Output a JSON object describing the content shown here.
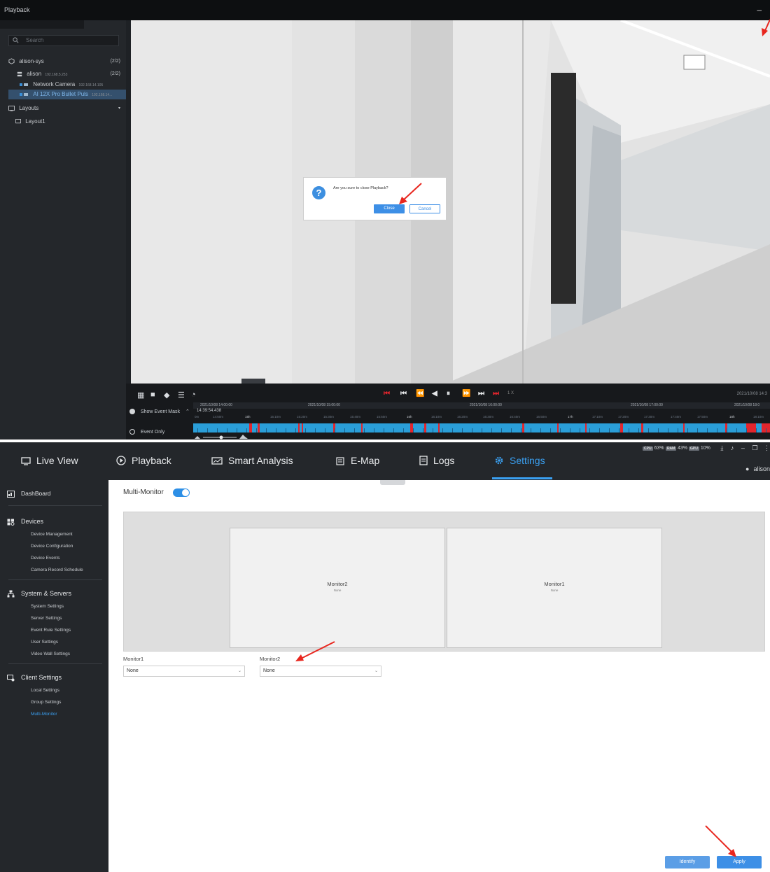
{
  "playback": {
    "title": "Playback",
    "min_glyph": "–",
    "search_placeholder": "Search",
    "tree": {
      "site": {
        "label": "alison-sys",
        "count": "(2/2)"
      },
      "server": {
        "label": "alison",
        "ip": "192.168.5.253",
        "count": "(2/2)"
      },
      "cameras": [
        {
          "label": "Network Camera",
          "ip": "192.168.14.105"
        },
        {
          "label": "AI 12X Pro Bullet Puls",
          "ip": "192.168.14..."
        }
      ],
      "layouts_label": "Layouts",
      "layout_items": [
        "Layout1"
      ]
    },
    "dialog": {
      "message": "Are you sure to close Playback?",
      "close_label": "Close",
      "cancel_label": "Cancel",
      "question_glyph": "?"
    },
    "speed": "1 X",
    "date_labels": [
      "2021/10/08 14:00:00",
      "2021/10/08 15:00:00",
      "2021/10/08 16:00:00",
      "2021/10/08 17:00:00",
      "2021/10/08 18:0"
    ],
    "right_datetime": "2021/10/08 14:3",
    "current_time": "14:39:54.438",
    "time_scale": [
      "0m",
      "14:50m",
      "15h",
      "15:10m",
      "15:20m",
      "15:30m",
      "15:40m",
      "15:50m",
      "16h",
      "16:10m",
      "16:20m",
      "16:30m",
      "16:40m",
      "16:50m",
      "17h",
      "17:10m",
      "17:20m",
      "17:30m",
      "17:40m",
      "17:50m",
      "18h",
      "18:10m"
    ],
    "show_event_mask": "Show Event Mask",
    "event_only": "Event Only",
    "colors": {
      "accent": "#2a9ed8",
      "event": "#e2252d"
    }
  },
  "settings": {
    "nav": [
      "Live View",
      "Playback",
      "Smart Analysis",
      "E-Map",
      "Logs",
      "Settings"
    ],
    "active_nav": "Settings",
    "stats": [
      {
        "chip": "CPU",
        "value": "63%"
      },
      {
        "chip": "RAM",
        "value": "43%"
      },
      {
        "chip": "GPU",
        "value": "10%"
      }
    ],
    "user": "alison",
    "sidebar": {
      "dashboard": "DashBoard",
      "devices": {
        "label": "Devices",
        "items": [
          "Device Management",
          "Device Configuration",
          "Device Events",
          "Camera Record Schedule"
        ]
      },
      "system": {
        "label": "System & Servers",
        "items": [
          "System Settings",
          "Server Settings",
          "Event Rule Settings",
          "User Settings",
          "Video Wall Settings"
        ]
      },
      "client": {
        "label": "Client Settings",
        "items": [
          "Local Settings",
          "Group Settings",
          "Multi-Monitor"
        ]
      }
    },
    "multi_monitor_label": "Multi-Monitor",
    "monitors": [
      {
        "name": "Monitor2",
        "value": "None"
      },
      {
        "name": "Monitor1",
        "value": "None"
      }
    ],
    "fields": [
      {
        "label": "Monitor1",
        "value": "None"
      },
      {
        "label": "Monitor2",
        "value": "None"
      }
    ],
    "identify_label": "Identify",
    "apply_label": "Apply",
    "colors": {
      "accent": "#3aa0f2",
      "button": "#3d8fe6",
      "annotation": "#e8261e"
    }
  }
}
